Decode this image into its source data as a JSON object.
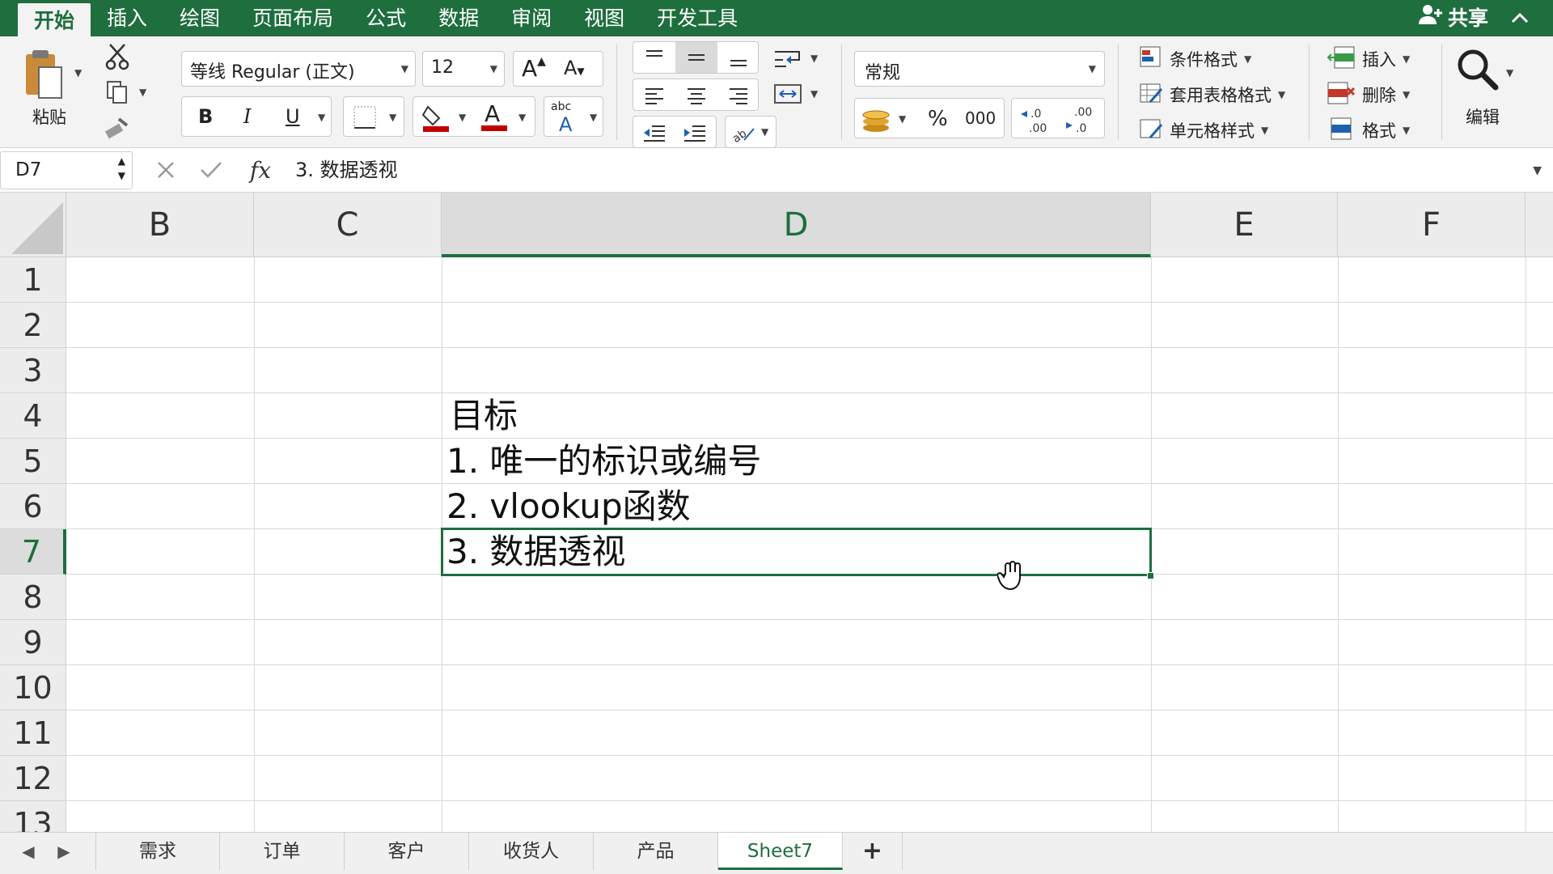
{
  "ribbon_tabs": [
    "开始",
    "插入",
    "绘图",
    "页面布局",
    "公式",
    "数据",
    "审阅",
    "视图",
    "开发工具"
  ],
  "share_label": "共享",
  "clipboard": {
    "paste_label": "粘贴"
  },
  "font": {
    "name": "等线 Regular (正文)",
    "size": "12"
  },
  "number": {
    "format": "常规",
    "percent": "%",
    "thousands": "000"
  },
  "styles": {
    "conditional": "条件格式",
    "table": "套用表格格式",
    "cell": "单元格样式"
  },
  "cells_group": {
    "insert": "插入",
    "delete": "删除",
    "format": "格式"
  },
  "editing": {
    "label": "编辑"
  },
  "formula_bar": {
    "name_box": "D7",
    "content": "3. 数据透视"
  },
  "columns": [
    "B",
    "C",
    "D",
    "E",
    "F"
  ],
  "selected_column": "D",
  "rows": [
    "1",
    "2",
    "3",
    "4",
    "5",
    "6",
    "7",
    "8",
    "9",
    "10",
    "11",
    "12",
    "13"
  ],
  "selected_row": "7",
  "cells": {
    "D4": "目标",
    "D5": "1. 唯一的标识或编号",
    "D6": "2. vlookup函数",
    "D7": "3. 数据透视"
  },
  "sheet_tabs": [
    "需求",
    "订单",
    "客户",
    "收货人",
    "产品",
    "Sheet7"
  ],
  "active_sheet": "Sheet7",
  "colors": {
    "accent": "#1e6e3e",
    "fill": "#c00000",
    "font": "#c00000"
  }
}
